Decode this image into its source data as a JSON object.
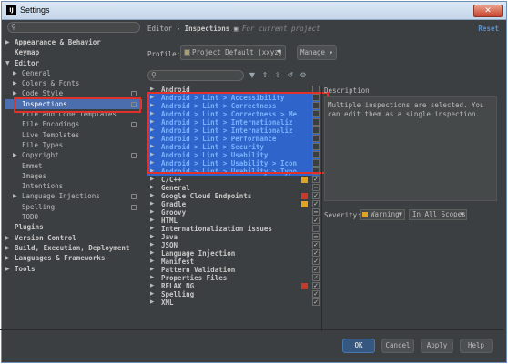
{
  "window": {
    "title": "Settings",
    "app_icon_label": "IJ",
    "close_icon": "close-x"
  },
  "left": {
    "search_placeholder": "",
    "tree": [
      {
        "label": "Appearance & Behavior",
        "arrow": "▶",
        "indent": 0,
        "bold": true
      },
      {
        "label": "Keymap",
        "arrow": "",
        "indent": 0,
        "bold": true
      },
      {
        "label": "Editor",
        "arrow": "▼",
        "indent": 0,
        "bold": true
      },
      {
        "label": "General",
        "arrow": "▶",
        "indent": 1
      },
      {
        "label": "Colors & Fonts",
        "arrow": "▶",
        "indent": 1
      },
      {
        "label": "Code Style",
        "arrow": "▶",
        "indent": 1,
        "proj": true
      },
      {
        "label": "Inspections",
        "arrow": "",
        "indent": 1,
        "proj": true,
        "selected": true
      },
      {
        "label": "File and Code Templates",
        "arrow": "",
        "indent": 1
      },
      {
        "label": "File Encodings",
        "arrow": "",
        "indent": 1,
        "proj": true
      },
      {
        "label": "Live Templates",
        "arrow": "",
        "indent": 1
      },
      {
        "label": "File Types",
        "arrow": "",
        "indent": 1
      },
      {
        "label": "Copyright",
        "arrow": "▶",
        "indent": 1,
        "proj": true
      },
      {
        "label": "Emmet",
        "arrow": "",
        "indent": 1
      },
      {
        "label": "Images",
        "arrow": "",
        "indent": 1
      },
      {
        "label": "Intentions",
        "arrow": "",
        "indent": 1
      },
      {
        "label": "Language Injections",
        "arrow": "▶",
        "indent": 1,
        "proj": true
      },
      {
        "label": "Spelling",
        "arrow": "",
        "indent": 1,
        "proj": true
      },
      {
        "label": "TODO",
        "arrow": "",
        "indent": 1
      },
      {
        "label": "Plugins",
        "arrow": "",
        "indent": 0,
        "bold": true
      },
      {
        "label": "Version Control",
        "arrow": "▶",
        "indent": 0,
        "bold": true
      },
      {
        "label": "Build, Execution, Deployment",
        "arrow": "▶",
        "indent": 0,
        "bold": true
      },
      {
        "label": "Languages & Frameworks",
        "arrow": "▶",
        "indent": 0,
        "bold": true
      },
      {
        "label": "Tools",
        "arrow": "▶",
        "indent": 0,
        "bold": true
      }
    ]
  },
  "header": {
    "breadcrumb_prefix": "Editor › ",
    "breadcrumb_current": "Inspections",
    "breadcrumb_hint": "For current project",
    "reset_label": "Reset"
  },
  "profile": {
    "label": "Profile:",
    "value": "Project Default (xxyz)",
    "manage_label": "Manage ▾"
  },
  "inspections": [
    {
      "label": "Android",
      "sel": false,
      "chk": "",
      "sev": ""
    },
    {
      "label": "Android > Lint > Accessibility",
      "sel": true,
      "chk": "",
      "sev": ""
    },
    {
      "label": "Android > Lint > Correctness",
      "sel": true,
      "chk": "",
      "sev": ""
    },
    {
      "label": "Android > Lint > Correctness > Me",
      "sel": true,
      "chk": "",
      "sev": ""
    },
    {
      "label": "Android > Lint > Internationaliz",
      "sel": true,
      "chk": "",
      "sev": ""
    },
    {
      "label": "Android > Lint > Internationaliz",
      "sel": true,
      "chk": "",
      "sev": ""
    },
    {
      "label": "Android > Lint > Performance",
      "sel": true,
      "chk": "",
      "sev": ""
    },
    {
      "label": "Android > Lint > Security",
      "sel": true,
      "chk": "",
      "sev": ""
    },
    {
      "label": "Android > Lint > Usability",
      "sel": true,
      "chk": "",
      "sev": ""
    },
    {
      "label": "Android > Lint > Usability > Icon",
      "sel": true,
      "chk": "",
      "sev": ""
    },
    {
      "label": "Android > Lint > Usability > Typo",
      "sel": true,
      "chk": "",
      "sev": ""
    },
    {
      "label": "C/C++",
      "sel": false,
      "chk": "✓",
      "sev": "#e0a425"
    },
    {
      "label": "General",
      "sel": false,
      "chk": "−",
      "sev": ""
    },
    {
      "label": "Google Cloud Endpoints",
      "sel": false,
      "chk": "✓",
      "sev": "#c83a2a"
    },
    {
      "label": "Gradle",
      "sel": false,
      "chk": "✓",
      "sev": "#e0a425"
    },
    {
      "label": "Groovy",
      "sel": false,
      "chk": "−",
      "sev": ""
    },
    {
      "label": "HTML",
      "sel": false,
      "chk": "✓",
      "sev": ""
    },
    {
      "label": "Internationalization issues",
      "sel": false,
      "chk": "",
      "sev": ""
    },
    {
      "label": "Java",
      "sel": false,
      "chk": "−",
      "sev": ""
    },
    {
      "label": "JSON",
      "sel": false,
      "chk": "✓",
      "sev": ""
    },
    {
      "label": "Language Injection",
      "sel": false,
      "chk": "✓",
      "sev": ""
    },
    {
      "label": "Manifest",
      "sel": false,
      "chk": "✓",
      "sev": ""
    },
    {
      "label": "Pattern Validation",
      "sel": false,
      "chk": "✓",
      "sev": ""
    },
    {
      "label": "Properties Files",
      "sel": false,
      "chk": "✓",
      "sev": ""
    },
    {
      "label": "RELAX NG",
      "sel": false,
      "chk": "✓",
      "sev": "#c83a2a"
    },
    {
      "label": "Spelling",
      "sel": false,
      "chk": "✓",
      "sev": ""
    },
    {
      "label": "XML",
      "sel": false,
      "chk": "✓",
      "sev": ""
    }
  ],
  "description": {
    "label": "Description",
    "text": "Multiple inspections are selected. You can edit them as a single inspection."
  },
  "severity": {
    "label": "Severity:",
    "value": "Warning",
    "scope": "In All Scopes"
  },
  "buttons": {
    "ok": "OK",
    "cancel": "Cancel",
    "apply": "Apply",
    "help": "Help"
  },
  "colors": {
    "background": "#3c3f41",
    "selection": "#2f65ca",
    "tree_selection": "#4b6eaf",
    "highlight_box": "#e0312b",
    "link": "#5f8fc7",
    "warning": "#e0a425",
    "error": "#c83a2a"
  }
}
